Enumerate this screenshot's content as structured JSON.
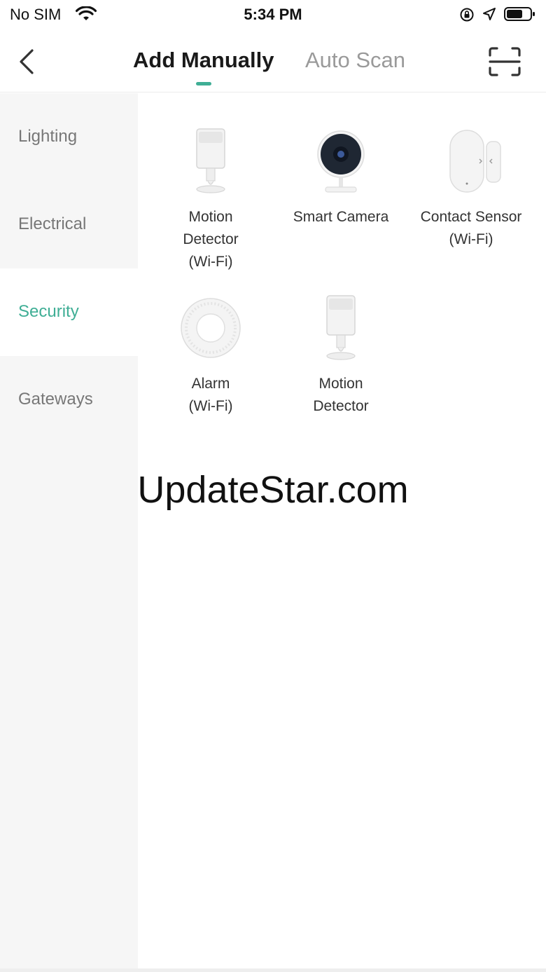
{
  "status_bar": {
    "carrier": "No SIM",
    "time": "5:34 PM",
    "icons": [
      "wifi-icon",
      "orientation-lock-icon",
      "location-icon",
      "battery-icon"
    ]
  },
  "nav": {
    "back_icon": "chevron-left-icon",
    "tabs": [
      {
        "label": "Add Manually",
        "active": true
      },
      {
        "label": "Auto Scan",
        "active": false
      }
    ],
    "scan_icon": "scan-frame-icon"
  },
  "sidebar": {
    "items": [
      {
        "label": "Lighting",
        "active": false
      },
      {
        "label": "Electrical",
        "active": false
      },
      {
        "label": "Security",
        "active": true
      },
      {
        "label": "Gateways",
        "active": false
      }
    ]
  },
  "devices": [
    {
      "label": "Motion\nDetector\n(Wi-Fi)",
      "icon": "motion-detector-icon"
    },
    {
      "label": "Smart Camera",
      "icon": "smart-camera-icon"
    },
    {
      "label": "Contact Sensor\n(Wi-Fi)",
      "icon": "contact-sensor-icon"
    },
    {
      "label": "Alarm\n(Wi-Fi)",
      "icon": "alarm-icon"
    },
    {
      "label": "Motion\nDetector",
      "icon": "motion-detector-icon"
    }
  ],
  "watermark": "UpdateStar.com",
  "colors": {
    "accent": "#3fae95",
    "sidebar_bg": "#f6f6f6",
    "inactive_text": "#9a9a9a"
  }
}
